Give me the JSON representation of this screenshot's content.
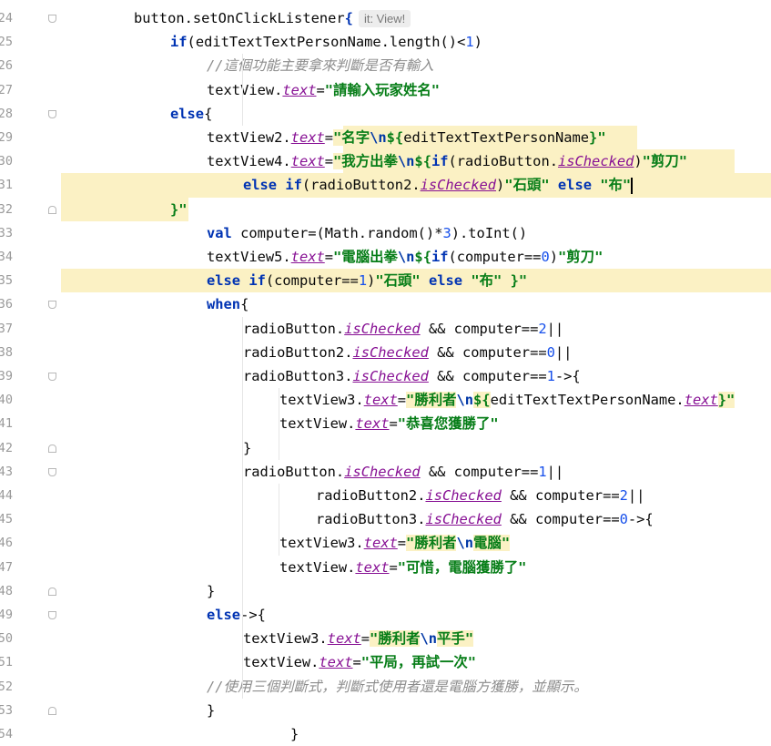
{
  "editor": {
    "line_numbers": [
      "24",
      "25",
      "26",
      "27",
      "28",
      "29",
      "30",
      "31",
      "32",
      "33",
      "34",
      "35",
      "36",
      "37",
      "38",
      "39",
      "40",
      "41",
      "42",
      "43",
      "44",
      "45",
      "46",
      "47",
      "48",
      "49",
      "50",
      "51",
      "52",
      "53",
      "54"
    ],
    "inlay_hint": "it: View!",
    "lines": [
      {
        "indent": 1,
        "tokens": [
          [
            "fn",
            "button.setOnClickListener"
          ],
          [
            "kw",
            "{"
          ]
        ],
        "hint": true
      },
      {
        "indent": 2,
        "tokens": [
          [
            "kw",
            "if"
          ],
          [
            "fn",
            "(editTextTextPersonName.length()"
          ],
          [
            "fn",
            "<"
          ],
          [
            "num",
            "1"
          ],
          [
            "fn",
            ")"
          ]
        ]
      },
      {
        "indent": 3,
        "tokens": [
          [
            "cmt",
            "//這個功能主要拿來判斷是否有輸入"
          ]
        ]
      },
      {
        "indent": 3,
        "tokens": [
          [
            "fn",
            "textView."
          ],
          [
            "prop",
            "text"
          ],
          [
            "fn",
            "="
          ],
          [
            "str",
            "\"請輸入玩家姓名\""
          ]
        ]
      },
      {
        "indent": 2,
        "tokens": [
          [
            "kw",
            "else"
          ],
          [
            "fn",
            "{"
          ]
        ]
      },
      {
        "indent": 3,
        "tokens": [
          [
            "fn",
            "textView2."
          ],
          [
            "prop",
            "text"
          ],
          [
            "fn",
            "="
          ],
          [
            "str-hl",
            "\"名字"
          ],
          [
            "esc",
            "\\n"
          ],
          [
            "str-hl",
            "${"
          ],
          [
            "fn",
            "editTextTextPersonName"
          ],
          [
            "str-hl",
            "}\""
          ]
        ]
      },
      {
        "indent": 3,
        "tokens": [
          [
            "fn",
            "textView4."
          ],
          [
            "prop",
            "text"
          ],
          [
            "fn",
            "="
          ],
          [
            "str-hl",
            "\"我方出拳"
          ],
          [
            "esc",
            "\\n"
          ],
          [
            "str-hl",
            "${"
          ],
          [
            "kw",
            "if"
          ],
          [
            "fn",
            "(radioButton."
          ],
          [
            "prop",
            "isChecked"
          ],
          [
            "fn",
            ")"
          ],
          [
            "str",
            "\"剪刀\""
          ]
        ]
      },
      {
        "indent": 4,
        "tokens": [
          [
            "kw",
            "else if"
          ],
          [
            "fn",
            "(radioButton2."
          ],
          [
            "prop",
            "isChecked"
          ],
          [
            "fn",
            ")"
          ],
          [
            "str",
            "\"石頭\""
          ],
          [
            "fn",
            " "
          ],
          [
            "kw",
            "else"
          ],
          [
            "fn",
            " "
          ],
          [
            "str",
            "\"布\""
          ]
        ],
        "caret": true
      },
      {
        "indent": 2,
        "tokens": [
          [
            "str",
            "}\""
          ]
        ]
      },
      {
        "indent": 3,
        "tokens": [
          [
            "kw",
            "val"
          ],
          [
            "fn",
            " computer=(Math.random()*"
          ],
          [
            "num",
            "3"
          ],
          [
            "fn",
            ").toInt()"
          ]
        ]
      },
      {
        "indent": 3,
        "tokens": [
          [
            "fn",
            "textView5."
          ],
          [
            "prop",
            "text"
          ],
          [
            "fn",
            "="
          ],
          [
            "str",
            "\"電腦出拳"
          ],
          [
            "esc",
            "\\n"
          ],
          [
            "str",
            "${"
          ],
          [
            "kw",
            "if"
          ],
          [
            "fn",
            "(computer=="
          ],
          [
            "num",
            "0"
          ],
          [
            "fn",
            ")"
          ],
          [
            "str",
            "\"剪刀\""
          ]
        ]
      },
      {
        "indent": 3,
        "tokens": [
          [
            "kw",
            "else if"
          ],
          [
            "fn",
            "(computer=="
          ],
          [
            "num",
            "1"
          ],
          [
            "fn",
            ")"
          ],
          [
            "str",
            "\"石頭\""
          ],
          [
            "fn",
            " "
          ],
          [
            "kw",
            "else"
          ],
          [
            "fn",
            " "
          ],
          [
            "str",
            "\"布\""
          ],
          [
            "fn",
            " "
          ],
          [
            "str",
            "}\""
          ]
        ]
      },
      {
        "indent": 3,
        "tokens": [
          [
            "kw",
            "when"
          ],
          [
            "fn",
            "{"
          ]
        ]
      },
      {
        "indent": 4,
        "tokens": [
          [
            "fn",
            "radioButton."
          ],
          [
            "prop",
            "isChecked"
          ],
          [
            "fn",
            " && computer=="
          ],
          [
            "num",
            "2"
          ],
          [
            "fn",
            "||"
          ]
        ]
      },
      {
        "indent": 4,
        "tokens": [
          [
            "fn",
            "radioButton2."
          ],
          [
            "prop",
            "isChecked"
          ],
          [
            "fn",
            " && computer=="
          ],
          [
            "num",
            "0"
          ],
          [
            "fn",
            "||"
          ]
        ]
      },
      {
        "indent": 4,
        "tokens": [
          [
            "fn",
            "radioButton3."
          ],
          [
            "prop",
            "isChecked"
          ],
          [
            "fn",
            " && computer=="
          ],
          [
            "num",
            "1"
          ],
          [
            "fn",
            "->{"
          ]
        ]
      },
      {
        "indent": 5,
        "tokens": [
          [
            "fn",
            "textView3."
          ],
          [
            "prop",
            "text"
          ],
          [
            "fn",
            "="
          ],
          [
            "str-hl",
            "\"勝利者"
          ],
          [
            "esc",
            "\\n"
          ],
          [
            "str-hl",
            "${"
          ],
          [
            "fn",
            "editTextTextPersonName."
          ],
          [
            "prop",
            "text"
          ],
          [
            "str-hl",
            "}\""
          ]
        ]
      },
      {
        "indent": 5,
        "tokens": [
          [
            "fn",
            "textView."
          ],
          [
            "prop",
            "text"
          ],
          [
            "fn",
            "="
          ],
          [
            "str",
            "\"恭喜您獲勝了\""
          ]
        ]
      },
      {
        "indent": 4,
        "tokens": [
          [
            "fn",
            "}"
          ]
        ]
      },
      {
        "indent": 4,
        "tokens": [
          [
            "fn",
            "radioButton."
          ],
          [
            "prop",
            "isChecked"
          ],
          [
            "fn",
            " && computer=="
          ],
          [
            "num",
            "1"
          ],
          [
            "fn",
            "||"
          ]
        ]
      },
      {
        "indent": 6,
        "tokens": [
          [
            "fn",
            "radioButton2."
          ],
          [
            "prop",
            "isChecked"
          ],
          [
            "fn",
            " && computer=="
          ],
          [
            "num",
            "2"
          ],
          [
            "fn",
            "||"
          ]
        ]
      },
      {
        "indent": 6,
        "tokens": [
          [
            "fn",
            "radioButton3."
          ],
          [
            "prop",
            "isChecked"
          ],
          [
            "fn",
            " && computer=="
          ],
          [
            "num",
            "0"
          ],
          [
            "fn",
            "->{"
          ]
        ]
      },
      {
        "indent": 5,
        "tokens": [
          [
            "fn",
            "textView3."
          ],
          [
            "prop",
            "text"
          ],
          [
            "fn",
            "="
          ],
          [
            "str-hl",
            "\"勝利者"
          ],
          [
            "esc",
            "\\n"
          ],
          [
            "str-hl",
            "電腦\""
          ]
        ]
      },
      {
        "indent": 5,
        "tokens": [
          [
            "fn",
            "textView."
          ],
          [
            "prop",
            "text"
          ],
          [
            "fn",
            "="
          ],
          [
            "str",
            "\"可惜，電腦獲勝了\""
          ]
        ]
      },
      {
        "indent": 3,
        "tokens": [
          [
            "fn",
            "}"
          ]
        ]
      },
      {
        "indent": 3,
        "tokens": [
          [
            "kw",
            "else"
          ],
          [
            "fn",
            "->{"
          ]
        ]
      },
      {
        "indent": 4,
        "tokens": [
          [
            "fn",
            "textView3."
          ],
          [
            "prop",
            "text"
          ],
          [
            "fn",
            "="
          ],
          [
            "str-hl",
            "\"勝利者"
          ],
          [
            "esc",
            "\\n"
          ],
          [
            "str-hl",
            "平手\""
          ]
        ]
      },
      {
        "indent": 4,
        "tokens": [
          [
            "fn",
            "textView."
          ],
          [
            "prop",
            "text"
          ],
          [
            "fn",
            "="
          ],
          [
            "str",
            "\"平局，再試一次\""
          ]
        ]
      },
      {
        "indent": 3,
        "tokens": [
          [
            "cmt",
            "//使用三個判斷式，判斷式使用者還是電腦方獲勝，並顯示。"
          ]
        ]
      },
      {
        "indent": 3,
        "tokens": [
          [
            "fn",
            "}"
          ]
        ]
      },
      {
        "indent": 5.3,
        "tokens": [
          [
            "fn",
            "}"
          ]
        ]
      }
    ]
  }
}
